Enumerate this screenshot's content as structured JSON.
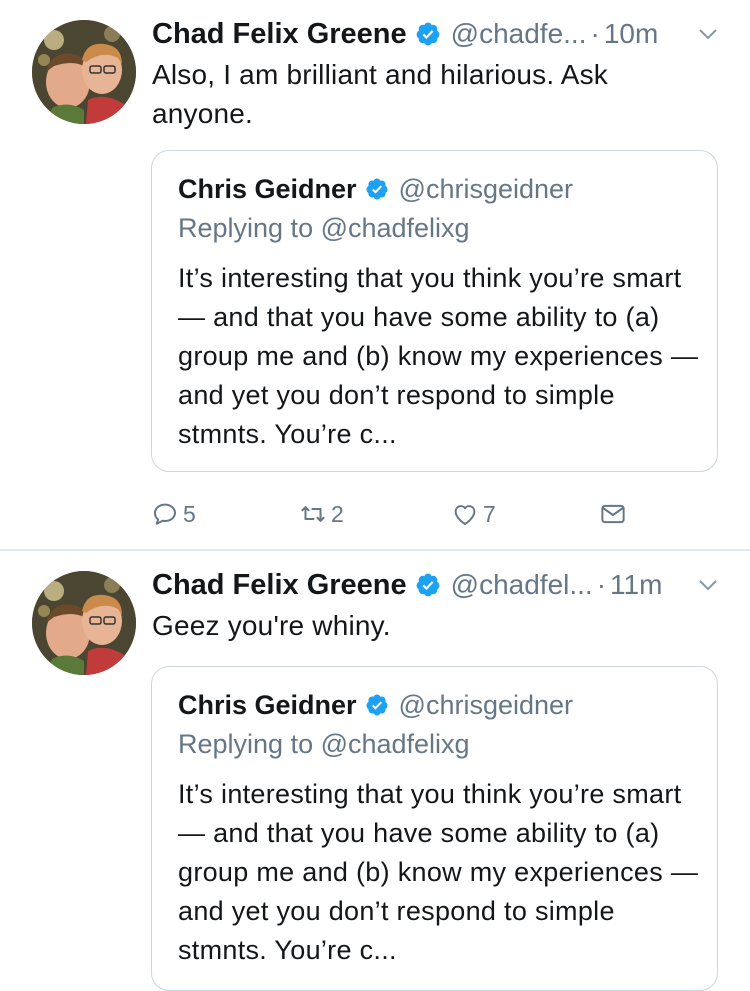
{
  "colors": {
    "verified": "#1da1f2",
    "secondary_text": "#657786",
    "primary_text": "#14171a",
    "border": "#ccd6dd"
  },
  "tweets": [
    {
      "author_name": "Chad Felix Greene",
      "author_handle": "@chadfe...",
      "separator": "·",
      "time": "10m",
      "text": "Also, I am brilliant and hilarious. Ask anyone.",
      "quote": {
        "author_name": "Chris Geidner",
        "author_handle": "@chrisgeidner",
        "replying_to": "Replying to @chadfelixg",
        "text": "It’s interesting that you think you’re smart — and that you have some ability to (a) group me and (b) know my experiences — and yet you don’t respond to simple stmnts. You’re c..."
      },
      "actions": {
        "reply_count": "5",
        "retweet_count": "2",
        "like_count": "7"
      }
    },
    {
      "author_name": "Chad Felix Greene",
      "author_handle": "@chadfel...",
      "separator": "·",
      "time": "11m",
      "text": "Geez you're whiny.",
      "quote": {
        "author_name": "Chris Geidner",
        "author_handle": "@chrisgeidner",
        "replying_to": "Replying to @chadfelixg",
        "text": "It’s interesting that you think you’re smart — and that you have some ability to (a) group me and (b) know my experiences — and yet you don’t respond to simple stmnts. You’re c..."
      }
    }
  ]
}
